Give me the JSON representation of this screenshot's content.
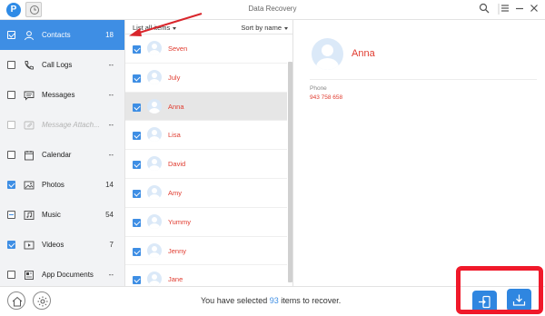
{
  "window": {
    "title": "Data Recovery",
    "logo_letter": "P"
  },
  "sidebar": {
    "items": [
      {
        "label": "Contacts",
        "count": "18",
        "state": "checked",
        "active": true,
        "icon": "person-icon"
      },
      {
        "label": "Call Logs",
        "count": "--",
        "state": "unchecked",
        "icon": "phone-icon"
      },
      {
        "label": "Messages",
        "count": "--",
        "state": "unchecked",
        "icon": "message-icon"
      },
      {
        "label": "Message Attach...",
        "count": "--",
        "state": "unchecked",
        "disabled": true,
        "icon": "paperclip-icon"
      },
      {
        "label": "Calendar",
        "count": "--",
        "state": "unchecked",
        "icon": "calendar-icon"
      },
      {
        "label": "Photos",
        "count": "14",
        "state": "checked",
        "icon": "photo-icon"
      },
      {
        "label": "Music",
        "count": "54",
        "state": "partial",
        "icon": "music-icon"
      },
      {
        "label": "Videos",
        "count": "7",
        "state": "checked",
        "icon": "video-icon"
      },
      {
        "label": "App Documents",
        "count": "--",
        "state": "unchecked",
        "icon": "document-icon"
      }
    ]
  },
  "list": {
    "header_left": "List all items",
    "header_right": "Sort by name",
    "rows": [
      {
        "name": "Seven",
        "checked": true
      },
      {
        "name": "July",
        "checked": true
      },
      {
        "name": "Anna",
        "checked": true,
        "selected": true
      },
      {
        "name": "Lisa",
        "checked": true
      },
      {
        "name": "David",
        "checked": true
      },
      {
        "name": "Amy",
        "checked": true
      },
      {
        "name": "Yummy",
        "checked": true
      },
      {
        "name": "Jenny",
        "checked": true
      },
      {
        "name": "Jane",
        "checked": true
      }
    ]
  },
  "detail": {
    "name": "Anna",
    "phone_label": "Phone",
    "phone_value": "943 758 658"
  },
  "footer": {
    "prefix": "You have selected ",
    "count": "93",
    "suffix": " items to recover."
  },
  "colors": {
    "accent": "#3e8ee4",
    "name_red": "#e03b2f",
    "annotation_red": "#f0192a"
  }
}
